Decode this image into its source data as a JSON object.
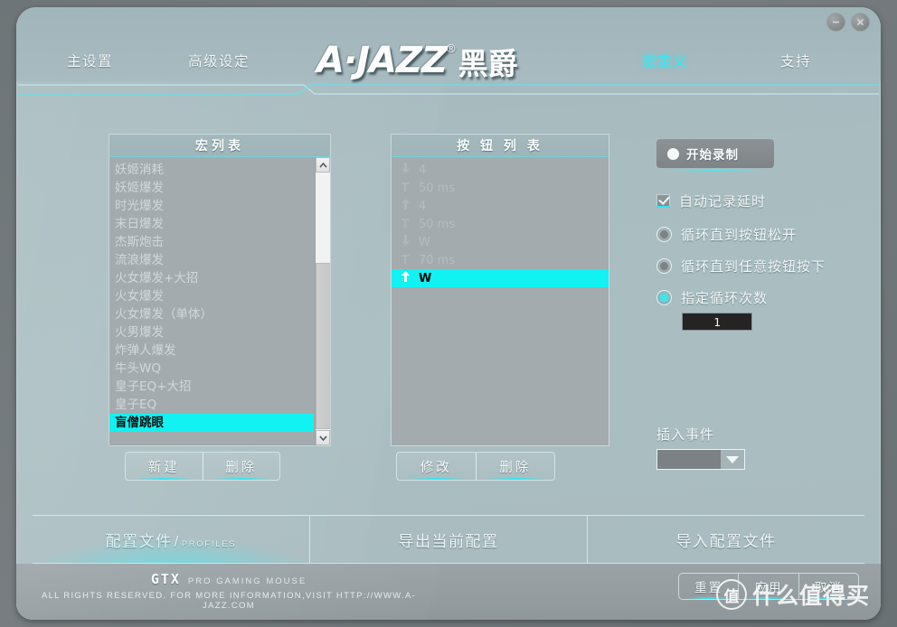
{
  "window": {
    "minimize_icon": "minimize-icon",
    "close_icon": "close-icon"
  },
  "header": {
    "nav": [
      {
        "label": "主设置",
        "active": false
      },
      {
        "label": "高级设定",
        "active": false
      },
      {
        "label": "宏定义",
        "active": true
      },
      {
        "label": "支持",
        "active": false
      }
    ],
    "logo": {
      "brand": "A·JAZZ",
      "registered": "®",
      "chinese": "黑爵"
    },
    "accent_color": "#2fe6f0"
  },
  "macro_panel": {
    "title": "宏列表",
    "items": [
      "妖姬消耗",
      "妖姬爆发",
      "时光爆发",
      "末日爆发",
      "杰斯炮击",
      "流浪爆发",
      "火女爆发+大招",
      "火女爆发",
      "火女爆发（单体）",
      "火男爆发",
      "炸弹人爆发",
      "牛头WQ",
      "皇子EQ+大招",
      "皇子EQ",
      "盲僧跳眼"
    ],
    "selected_index": 14,
    "scrollbar": {
      "up_icon": "chevron-up-icon",
      "down_icon": "chevron-down-icon"
    },
    "buttons": [
      {
        "label": "新建"
      },
      {
        "label": "删除"
      }
    ]
  },
  "button_panel": {
    "title": "按 钮 列 表",
    "items": [
      {
        "icon": "arrow-down-icon",
        "label": "4"
      },
      {
        "icon": "delay-icon",
        "label": "50 ms"
      },
      {
        "icon": "arrow-up-icon",
        "label": "4"
      },
      {
        "icon": "delay-icon",
        "label": "50 ms"
      },
      {
        "icon": "arrow-down-icon",
        "label": "W"
      },
      {
        "icon": "delay-icon",
        "label": "70 ms"
      },
      {
        "icon": "arrow-up-icon",
        "label": "W"
      }
    ],
    "selected_index": 6,
    "buttons": [
      {
        "label": "修改"
      },
      {
        "label": "删除"
      }
    ]
  },
  "record_panel": {
    "record_button": {
      "label": "开始录制",
      "icon": "record-dot-icon"
    },
    "auto_delay": {
      "label": "自动记录延时",
      "checked": true
    },
    "loop_options": [
      {
        "label": "循环直到按钮松开",
        "selected": false
      },
      {
        "label": "循环直到任意按钮按下",
        "selected": false
      },
      {
        "label": "指定循环次数",
        "selected": true
      }
    ],
    "loop_count_value": "1",
    "insert_event": {
      "label": "插入事件",
      "value": "",
      "caret_icon": "chevron-down-icon"
    }
  },
  "tabbar": [
    {
      "label": "配置文件",
      "slash": "/",
      "sub": "PROFILES",
      "active": true
    },
    {
      "label": "导出当前配置",
      "slash": "",
      "sub": "",
      "active": false
    },
    {
      "label": "导入配置文件",
      "slash": "",
      "sub": "",
      "active": false
    }
  ],
  "footer": {
    "brand": "GTX",
    "brand_sub": "PRO GAMING MOUSE",
    "copyright": "ALL RIGHTS RESERVED. FOR MORE INFORMATION,VISIT HTTP://WWW.A-JAZZ.COM",
    "actions": [
      {
        "label": "重置"
      },
      {
        "label": "应用"
      },
      {
        "label": "取消"
      }
    ]
  },
  "watermark": {
    "mark": "值",
    "text": "什么值得买"
  }
}
